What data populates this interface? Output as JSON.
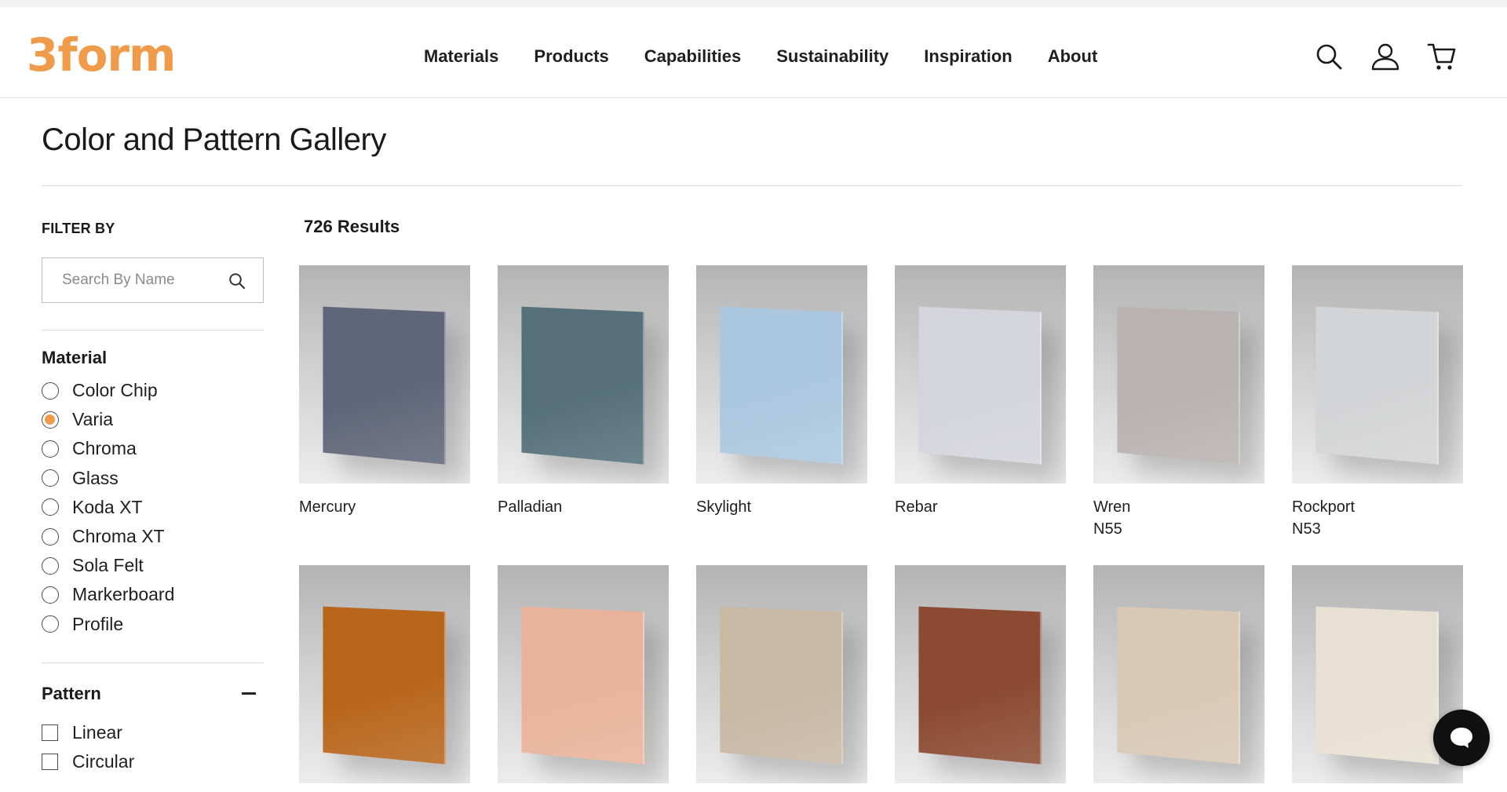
{
  "brand": {
    "logo_text": "3form",
    "accent": "#ef9b4a"
  },
  "nav": {
    "items": [
      {
        "label": "Materials"
      },
      {
        "label": "Products"
      },
      {
        "label": "Capabilities"
      },
      {
        "label": "Sustainability"
      },
      {
        "label": "Inspiration"
      },
      {
        "label": "About"
      }
    ],
    "icons": [
      "search-icon",
      "account-icon",
      "cart-icon"
    ]
  },
  "page": {
    "title": "Color and Pattern Gallery"
  },
  "filters": {
    "heading": "FILTER BY",
    "search": {
      "placeholder": "Search By Name",
      "value": ""
    },
    "material": {
      "title": "Material",
      "options": [
        {
          "label": "Color Chip",
          "checked": false
        },
        {
          "label": "Varia",
          "checked": true
        },
        {
          "label": "Chroma",
          "checked": false
        },
        {
          "label": "Glass",
          "checked": false
        },
        {
          "label": "Koda XT",
          "checked": false
        },
        {
          "label": "Chroma XT",
          "checked": false
        },
        {
          "label": "Sola Felt",
          "checked": false
        },
        {
          "label": "Markerboard",
          "checked": false
        },
        {
          "label": "Profile",
          "checked": false
        }
      ]
    },
    "pattern": {
      "title": "Pattern",
      "options": [
        {
          "label": "Linear",
          "checked": false
        },
        {
          "label": "Circular",
          "checked": false
        }
      ]
    }
  },
  "results": {
    "count_label": "726 Results",
    "items": [
      {
        "name": "Mercury",
        "code": "",
        "color": "#5f6679"
      },
      {
        "name": "Palladian",
        "code": "",
        "color": "#55707a"
      },
      {
        "name": "Skylight",
        "code": "",
        "color": "#abc7de"
      },
      {
        "name": "Rebar",
        "code": "",
        "color": "#d4d4dc"
      },
      {
        "name": "Wren",
        "code": "N55",
        "color": "#b9b2b0"
      },
      {
        "name": "Rockport",
        "code": "N53",
        "color": "#d3d4d5"
      },
      {
        "name": "",
        "code": "",
        "color": "#b8661c"
      },
      {
        "name": "",
        "code": "",
        "color": "#e9b39b"
      },
      {
        "name": "",
        "code": "",
        "color": "#c8b8a4"
      },
      {
        "name": "",
        "code": "",
        "color": "#8b4a31"
      },
      {
        "name": "",
        "code": "",
        "color": "#d8c8b4"
      },
      {
        "name": "",
        "code": "",
        "color": "#e8e0d2"
      }
    ]
  },
  "chat": {
    "icon": "chat-icon"
  }
}
